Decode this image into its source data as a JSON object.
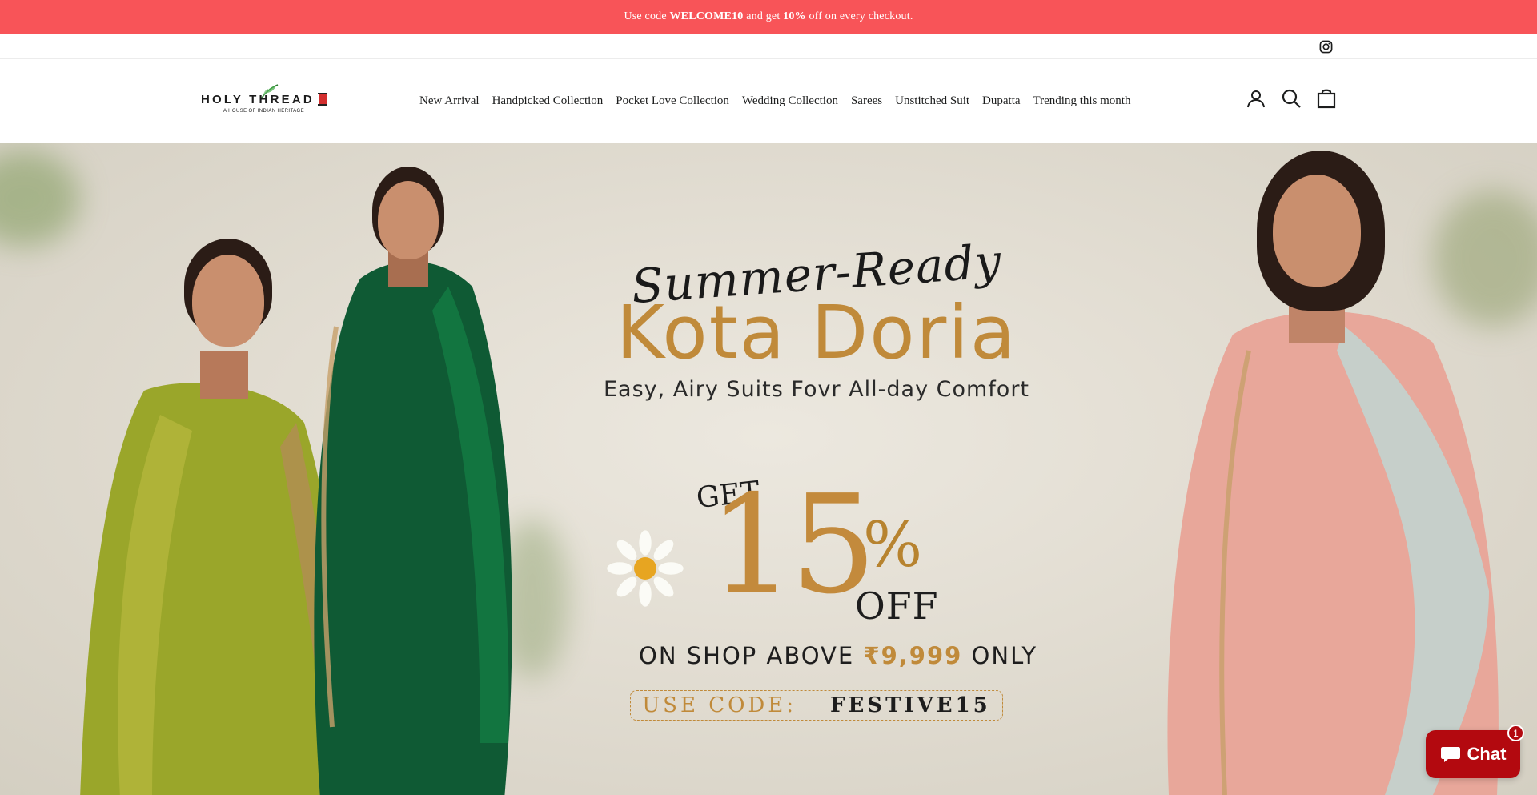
{
  "announcement": {
    "prefix": "Use code",
    "code": "WELCOME10",
    "middle": "and get",
    "percent": "10%",
    "suffix": "off on every checkout."
  },
  "utility": {
    "social_icon": "instagram-icon"
  },
  "header": {
    "logo_text": "HOLY THREAD",
    "logo_subtitle": "A HOUSE OF INDIAN HERITAGE",
    "nav": [
      {
        "label": "New Arrival"
      },
      {
        "label": "Handpicked Collection"
      },
      {
        "label": "Pocket Love Collection"
      },
      {
        "label": "Wedding Collection"
      },
      {
        "label": "Sarees"
      },
      {
        "label": "Unstitched Suit"
      },
      {
        "label": "Dupatta"
      },
      {
        "label": "Trending this month"
      }
    ],
    "icons": [
      "account-icon",
      "search-icon",
      "cart-icon"
    ]
  },
  "hero": {
    "script_title": "Summer-Ready",
    "main_title": "Kota Doria",
    "tagline": "Easy, Airy Suits Fovr All-day Comfort",
    "get": "GET",
    "discount_number": "15",
    "discount_symbol": "%",
    "off": "OFF",
    "shop_prefix": "ON SHOP ABOVE",
    "shop_amount": "₹9,999",
    "shop_suffix": "ONLY",
    "code_label": "USE CODE:",
    "code_value": "FESTIVE15"
  },
  "chat": {
    "label": "Chat",
    "badge": "1"
  },
  "colors": {
    "announcement_bg": "#f85458",
    "accent_gold": "#c08a3a",
    "chat_bg": "#b3090f"
  }
}
